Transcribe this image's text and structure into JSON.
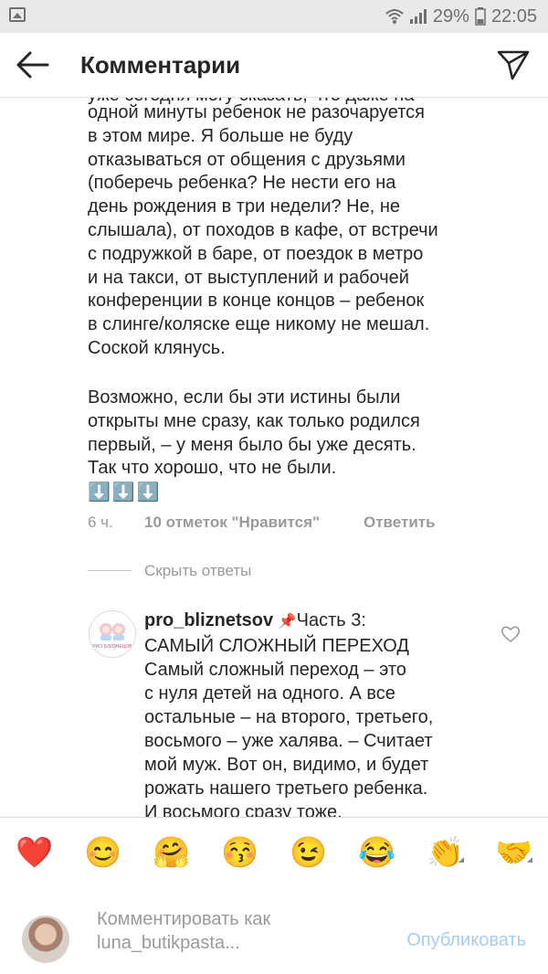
{
  "status_bar": {
    "battery": "29%",
    "time": "22:05"
  },
  "header": {
    "title": "Комментарии"
  },
  "comment": {
    "text_part1": "одной минуты ребенок не разочаруется\nв этом мире. Я больше не буду\nотказываться от общения с друзьями\n(поберечь ребенка? Не нести его на\nдень рождения в три недели? Не, не\nслышала), от походов в кафе, от встречи\nс подружкой в баре, от поездок в метро\nи на такси, от выступлений и рабочей\nконференции в конце концов – ребенок\nв слинге/коляске еще никому не мешал.\nСоской клянусь.",
    "text_part2": "Возможно, если бы эти истины были\nоткрыты мне сразу, как только родился\nпервый, – у меня было бы уже десять.\nТак что хорошо, что не были.",
    "arrows": "⬇️⬇️⬇️",
    "time": "6 ч.",
    "likes": "10 отметок \"Нравится\"",
    "reply_label": "Ответить"
  },
  "replies_toggle": {
    "label": "Скрыть ответы"
  },
  "reply": {
    "username": "pro_bliznetsov",
    "pin_icon": "📌",
    "heading": "Часть 3:",
    "subheading": "САМЫЙ СЛОЖНЫЙ ПЕРЕХОД",
    "body": "Самый сложный переход – это\nс нуля детей на одного. А все\nостальные – на второго, третьего,\nвосьмого – уже халява. – Считает\nмой муж. Вот он, видимо, и будет\nрожать нашего третьего ребенка.\nИ восьмого сразу тоже.",
    "avatar_logo": "PRO БЛИЗНЕЦОВ"
  },
  "emoji_bar": {
    "emojis": [
      "❤️",
      "😊",
      "🤗",
      "😚",
      "😉",
      "😂",
      "👏",
      "🤝"
    ]
  },
  "composer": {
    "placeholder_line1": "Комментировать как",
    "placeholder_line2": "luna_butikpasta...",
    "publish_label": "Опубликовать"
  },
  "colors": {
    "text": "#262626",
    "muted": "#9a9a9a",
    "publish_disabled": "#a6cdf6",
    "status_bar_bg": "#e9e9e9"
  }
}
